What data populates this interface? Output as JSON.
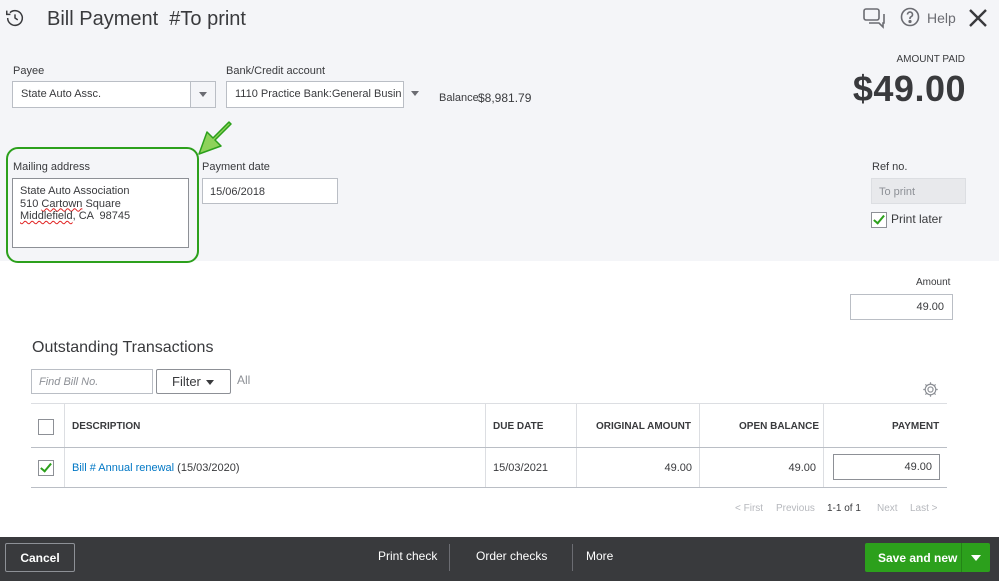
{
  "header": {
    "title": "Bill Payment",
    "title_tag": "#To print",
    "help_label": "Help"
  },
  "form": {
    "payee_label": "Payee",
    "payee_value": "State Auto Assc.",
    "account_label": "Bank/Credit account",
    "account_value": "1110 Practice Bank:General Busin",
    "balance_label": "Balance",
    "balance_value": "$8,981.79",
    "amount_paid_label": "AMOUNT PAID",
    "amount_paid_value": "$49.00",
    "mailing_label": "Mailing address",
    "mailing_line1": "State Auto Association",
    "mailing_line2_pre": "510 ",
    "mailing_line2_sq": "Cartown",
    "mailing_line2_post": " Square",
    "mailing_line3_sq": "Middlefield",
    "mailing_line3_post": ", CA  98745",
    "payment_date_label": "Payment date",
    "payment_date_value": "15/06/2018",
    "ref_label": "Ref no.",
    "ref_placeholder": "To print",
    "print_later_label": "Print later",
    "print_later_checked": true,
    "amount_label": "Amount",
    "amount_value": "49.00"
  },
  "outstanding": {
    "title": "Outstanding Transactions",
    "find_placeholder": "Find Bill No.",
    "filter_label": "Filter",
    "all_label": "All",
    "columns": [
      "DESCRIPTION",
      "DUE DATE",
      "ORIGINAL AMOUNT",
      "OPEN BALANCE",
      "PAYMENT"
    ],
    "rows": [
      {
        "checked": true,
        "description_link": "Bill # Annual renewal",
        "description_date": " (15/03/2020)",
        "due_date": "15/03/2021",
        "original_amount": "49.00",
        "open_balance": "49.00",
        "payment": "49.00"
      }
    ],
    "pager": {
      "first": "< First",
      "previous": "Previous",
      "range": "1-1 of 1",
      "next": "Next",
      "last": "Last >"
    }
  },
  "footer": {
    "cancel": "Cancel",
    "print_check": "Print check",
    "order_checks": "Order checks",
    "more": "More",
    "save_and_new": "Save and new"
  },
  "colors": {
    "accent_green": "#2ca01c",
    "link_blue": "#0077c5",
    "footer_bg": "#393a3d",
    "header_bg": "#f4f5f8"
  }
}
